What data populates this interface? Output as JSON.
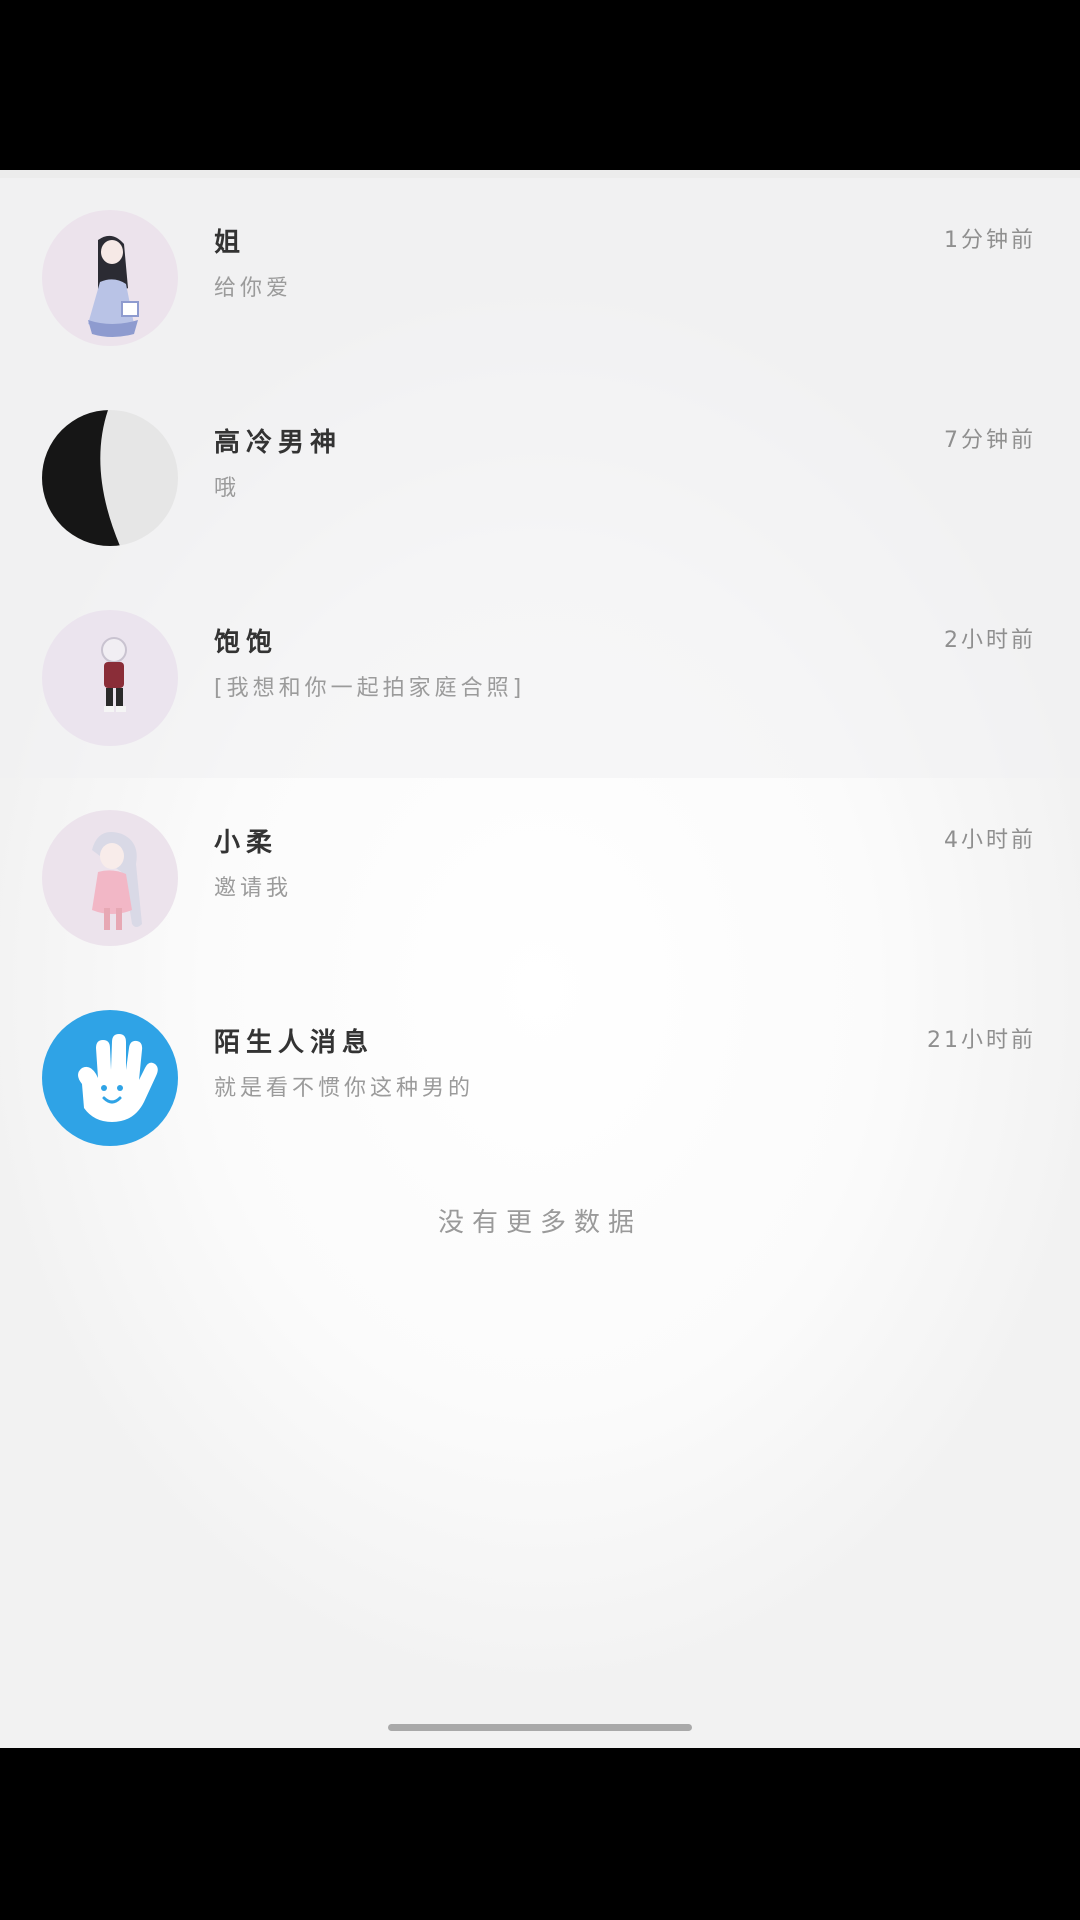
{
  "conversations": [
    {
      "name": "姐",
      "preview": "给你爱",
      "time": "1分钟前",
      "avatar_icon": "anime-girl-avatar-icon"
    },
    {
      "name": "高冷男神",
      "preview": "哦",
      "time": "7分钟前",
      "avatar_icon": "black-white-avatar-icon"
    },
    {
      "name": "饱饱",
      "preview": "[我想和你一起拍家庭合照]",
      "time": "2小时前",
      "avatar_icon": "anime-chibi-avatar-icon"
    },
    {
      "name": "小柔",
      "preview": "邀请我",
      "time": "4小时前",
      "avatar_icon": "anime-twintail-avatar-icon"
    },
    {
      "name": "陌生人消息",
      "preview": "就是看不惯你这种男的",
      "time": "21小时前",
      "avatar_icon": "waving-hand-icon"
    }
  ],
  "footer": {
    "no_more": "没有更多数据"
  },
  "colors": {
    "accent_blue": "#2fa3e6",
    "avatar_bg": "#ece3ec",
    "text_dark": "#333333",
    "text_muted": "#9b9b9b"
  }
}
